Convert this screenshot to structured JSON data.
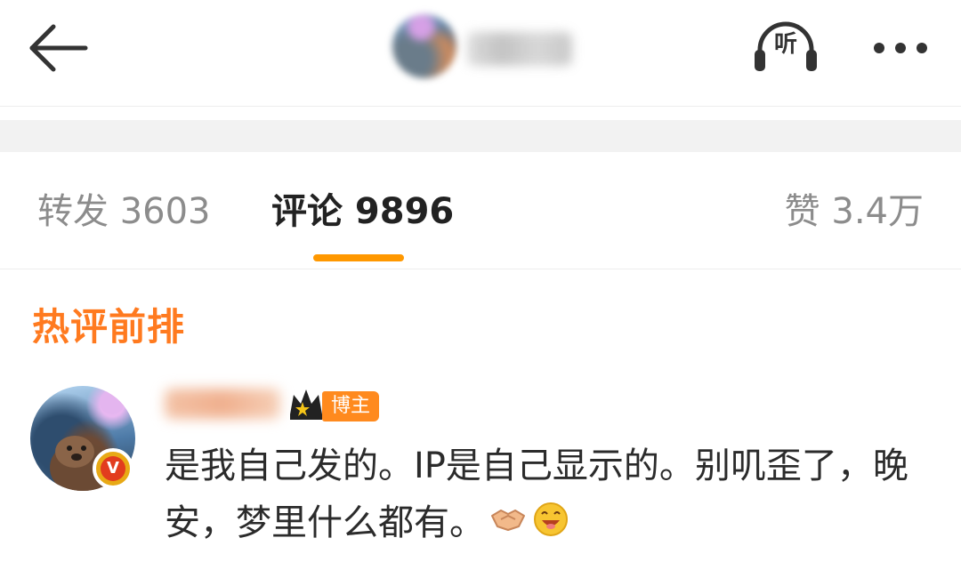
{
  "header": {
    "listen_label": "听",
    "icons": {
      "back": "arrow-left-icon",
      "listen": "headphones-icon",
      "more": "more-dots-icon"
    }
  },
  "tabs": {
    "repost": "转发 3603",
    "comments": "评论 9896",
    "likes": "赞 3.4万"
  },
  "section_title": "热评前排",
  "comment": {
    "badge_label": "博主",
    "verified_mark": "V",
    "text": "是我自己发的。IP是自己显示的。别叽歪了，晚安，梦里什么都有。",
    "emojis": [
      "handshake-emoji",
      "laughing-face-emoji"
    ]
  },
  "colors": {
    "accent": "#ff9800",
    "section_title": "#ff7a1f",
    "badge": "#ff8a1e",
    "text_primary": "#222222",
    "text_secondary": "#8c8c8c"
  }
}
